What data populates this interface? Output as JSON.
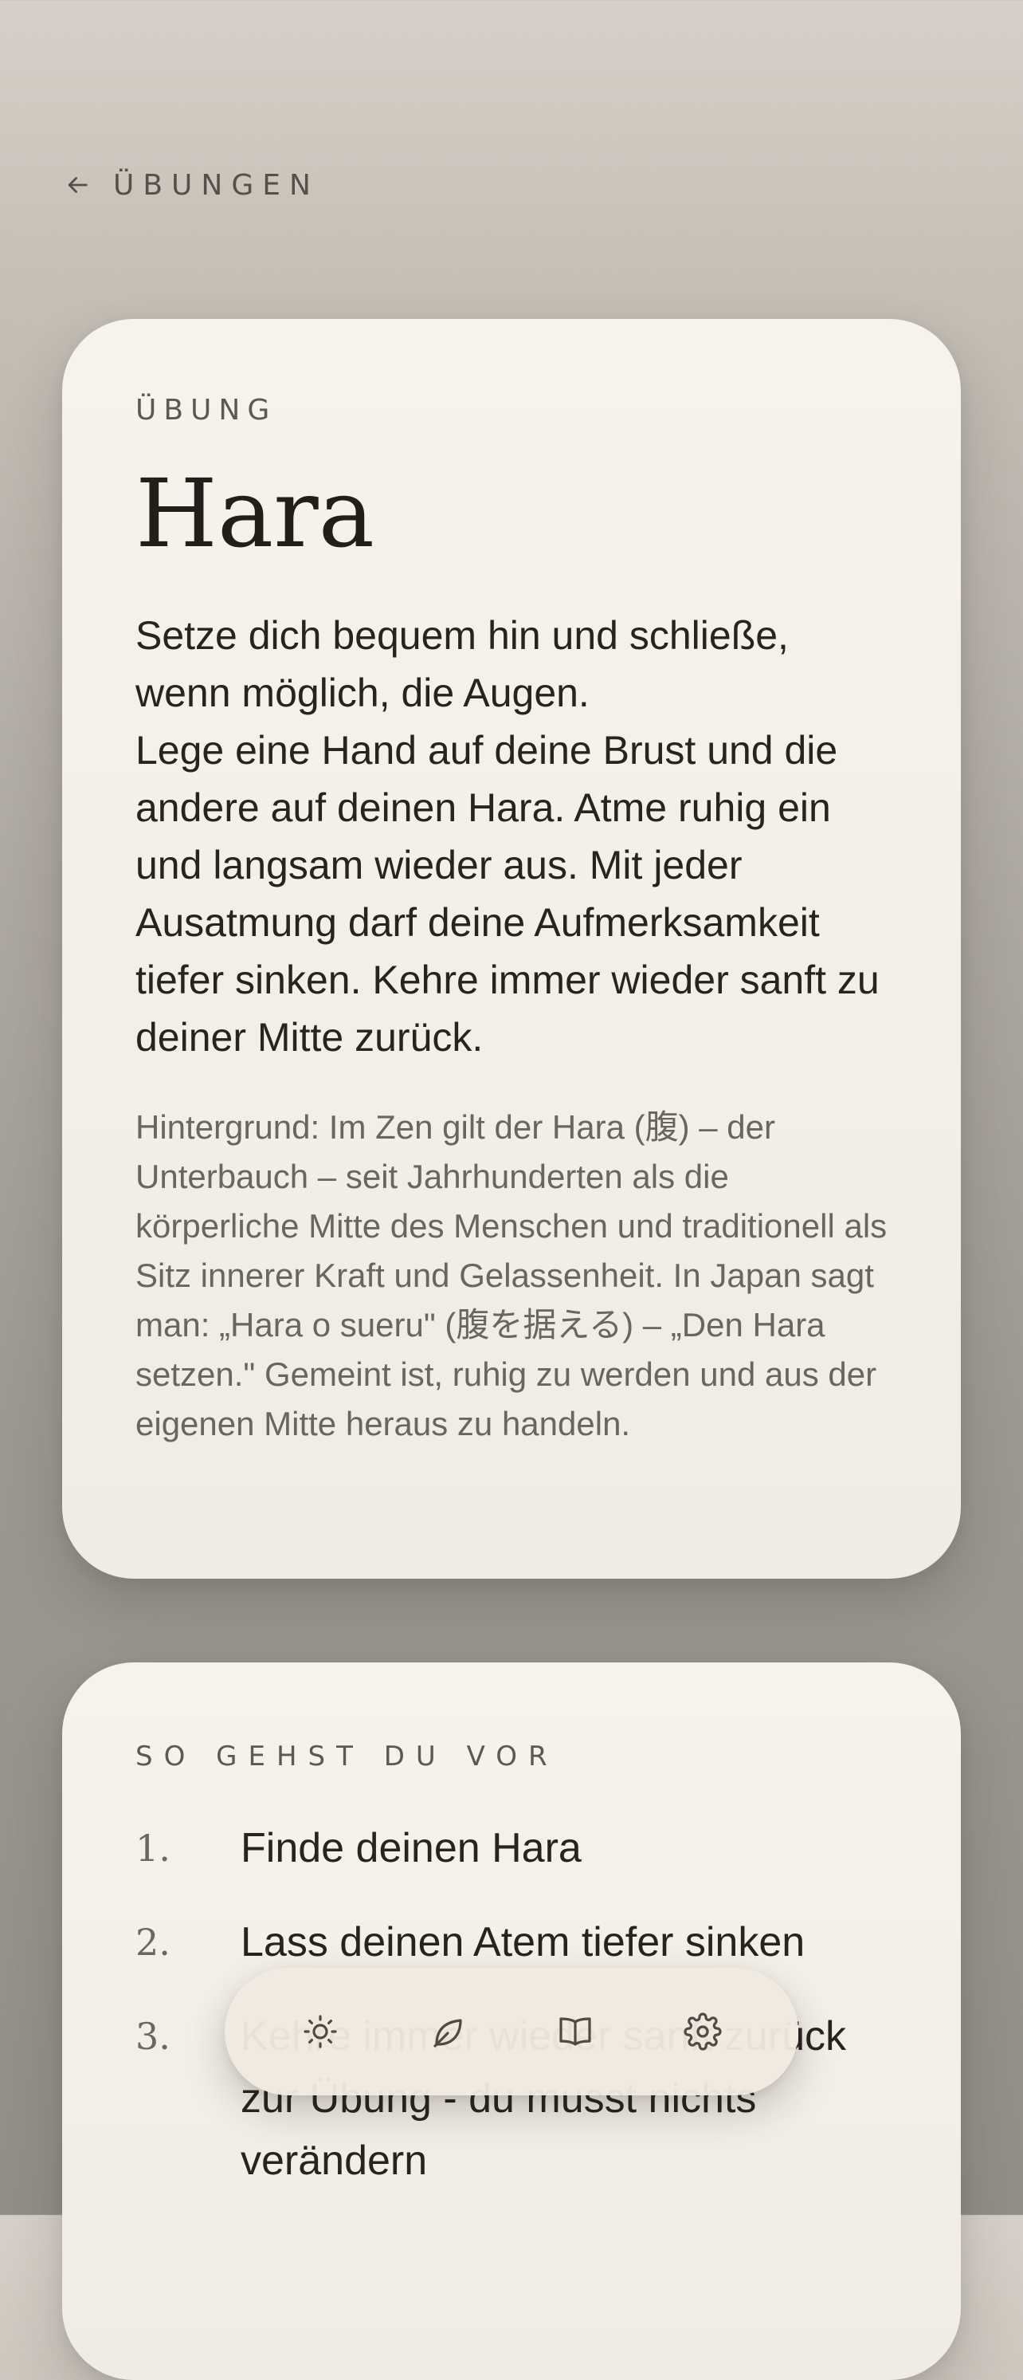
{
  "nav": {
    "back_label": "ÜBUNGEN"
  },
  "exercise": {
    "eyebrow": "ÜBUNG",
    "title": "Hara",
    "instructions": [
      "Setze dich bequem hin und schließe, wenn möglich, die Augen.",
      "Lege eine Hand auf deine Brust und die andere auf deinen Hara. Atme ruhig ein und langsam wieder aus. Mit jeder Ausatmung darf deine Aufmerksamkeit tiefer sinken. Kehre immer wieder sanft zu deiner Mitte zurück."
    ],
    "background": "Hintergrund: Im Zen gilt der Hara (腹) – der Unterbauch – seit Jahrhunderten als die körperliche Mitte des Menschen und traditionell als Sitz innerer Kraft und Gelassenheit. In Japan sagt man: „Hara o sueru\" (腹を据える) – „Den Hara setzen.\" Gemeint ist, ruhig zu werden und aus der eigenen Mitte heraus zu handeln."
  },
  "steps_section": {
    "eyebrow": "SO GEHST DU VOR",
    "steps": [
      {
        "num": "1.",
        "text": "Finde deinen Hara"
      },
      {
        "num": "2.",
        "text": "Lass deinen Atem tiefer sinken"
      },
      {
        "num": "3.",
        "text": "Kehre immer wieder sanft zurück zur Übung - du musst nichts verändern"
      }
    ]
  },
  "tabbar": {
    "items": [
      {
        "icon": "sun-icon"
      },
      {
        "icon": "leaf-icon"
      },
      {
        "icon": "book-icon"
      },
      {
        "icon": "gear-icon"
      }
    ]
  },
  "colors": {
    "card": "#f4f0ea",
    "text": "#27231f",
    "muted": "#6a655f"
  }
}
